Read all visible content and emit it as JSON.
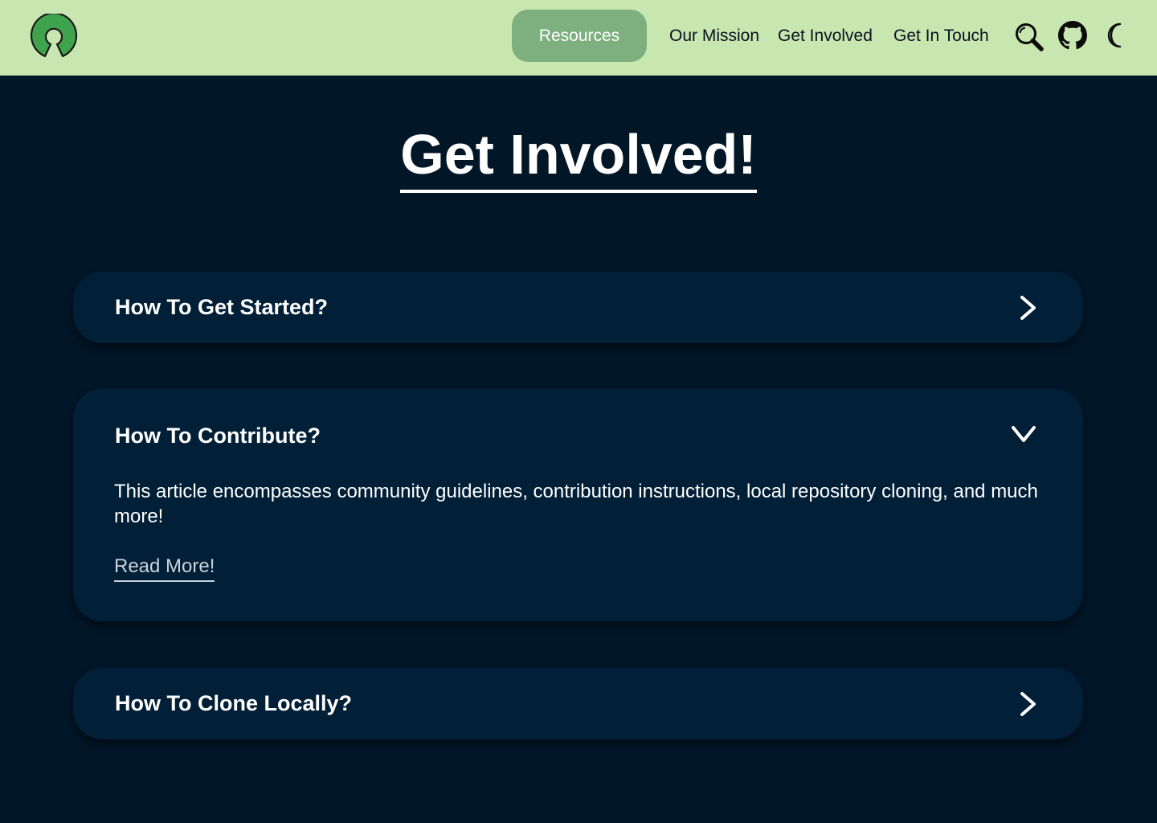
{
  "nav": {
    "logo_icon": "open-source-logo-icon",
    "resources_label": "Resources",
    "links": [
      {
        "label": "Our Mission"
      },
      {
        "label": "Get Involved"
      },
      {
        "label": "Get In Touch"
      }
    ],
    "icons": [
      "search-icon",
      "github-icon",
      "moon-icon"
    ]
  },
  "page": {
    "title": "Get Involved!"
  },
  "faq": [
    {
      "question": "How To Get Started?",
      "expanded": false,
      "icon": "chevron-right-icon"
    },
    {
      "question": "How To Contribute?",
      "expanded": true,
      "icon": "chevron-down-icon",
      "answer": "This article encompasses community guidelines, contribution instructions, local repository cloning, and much more!",
      "link_label": "Read More!"
    },
    {
      "question": "How To Clone Locally?",
      "expanded": false,
      "icon": "chevron-right-icon"
    }
  ],
  "colors": {
    "nav_bg": "#C8E6B0",
    "nav_active_bg": "#7DB07E",
    "page_bg": "#011627",
    "card_bg": "#011F37",
    "logo_green": "#3FA34D"
  }
}
